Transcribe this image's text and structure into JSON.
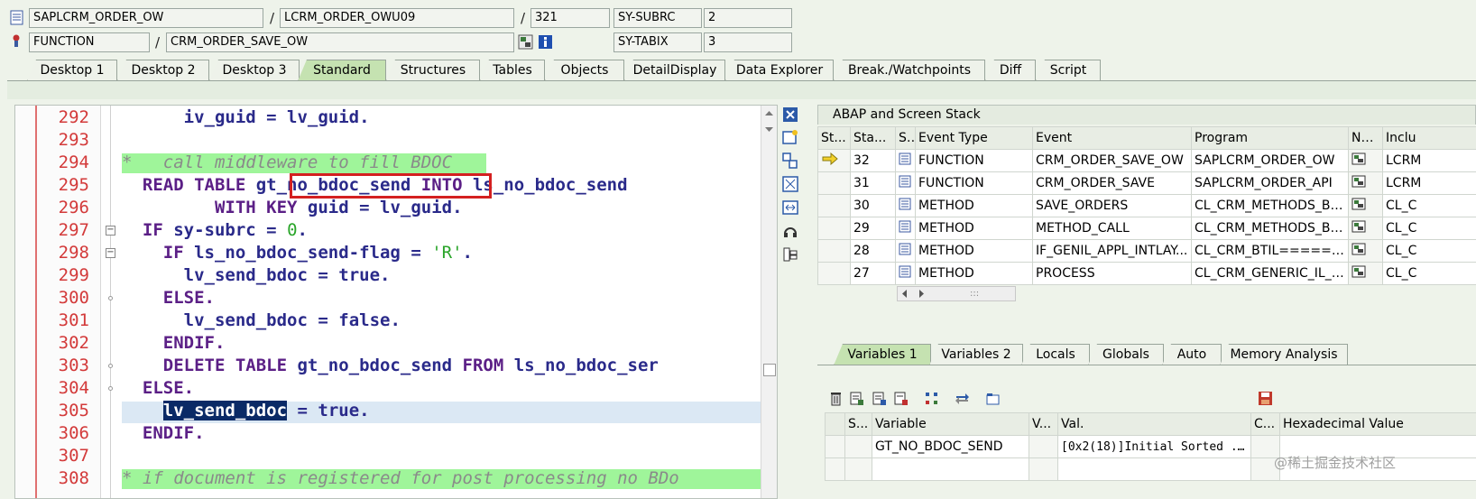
{
  "header": {
    "program": "SAPLCRM_ORDER_OW",
    "include": "LCRM_ORDER_OWU09",
    "line": "321",
    "sy_subrc_label": "SY-SUBRC",
    "sy_subrc_value": "2",
    "type": "FUNCTION",
    "name": "CRM_ORDER_SAVE_OW",
    "sy_tabix_label": "SY-TABIX",
    "sy_tabix_value": "3",
    "sep": "/"
  },
  "tabs": [
    "Desktop 1",
    "Desktop 2",
    "Desktop 3",
    "Standard",
    "Structures",
    "Tables",
    "Objects",
    "DetailDisplay",
    "Data Explorer",
    "Break./Watchpoints",
    "Diff",
    "Script"
  ],
  "editor": {
    "line_numbers": [
      "292",
      "293",
      "294",
      "295",
      "296",
      "297",
      "298",
      "299",
      "300",
      "301",
      "302",
      "303",
      "304",
      "305",
      "306",
      "307",
      "308"
    ]
  },
  "code": {
    "l292a": "iv_guid",
    "l292b": " = ",
    "l292c": "lv_guid",
    "l292d": ".",
    "l294": "*   call middleware to fill BDOC",
    "l295a": "READ TABLE ",
    "l295b": "gt_no_bdoc_send",
    "l295c": " INTO ",
    "l295d": "ls_no_bdoc_send",
    "l296a": "WITH KEY ",
    "l296b": "guid",
    "l296c": " = ",
    "l296d": "lv_guid",
    "l296e": ".",
    "l297a": "IF ",
    "l297b": "sy-subrc",
    "l297c": " = ",
    "l297d": "0",
    "l297e": ".",
    "l298a": "IF ",
    "l298b": "ls_no_bdoc_send-flag",
    "l298c": " = ",
    "l298d": "'R'",
    "l298e": ".",
    "l299a": "lv_send_bdoc",
    "l299b": " = ",
    "l299c": "true",
    "l299d": ".",
    "l300": "ELSE.",
    "l301a": "lv_send_bdoc",
    "l301b": " = ",
    "l301c": "false",
    "l301d": ".",
    "l302": "ENDIF.",
    "l303a": "DELETE TABLE ",
    "l303b": "gt_no_bdoc_send",
    "l303c": " FROM ",
    "l303d": "ls_no_bdoc_ser",
    "l304": "ELSE.",
    "l305a": "lv_send_bdoc",
    "l305b": " = ",
    "l305c": "true",
    "l305d": ".",
    "l306": "ENDIF.",
    "l308": "* if document is registered for post processing no BDo"
  },
  "stack": {
    "title": "ABAP and Screen Stack",
    "columns": [
      "St...",
      "Sta...",
      "S...",
      "Event Type",
      "Event",
      "Program",
      "Na...",
      "Inclu"
    ],
    "rows": [
      {
        "level": "32",
        "type": "FUNCTION",
        "event": "CRM_ORDER_SAVE_OW",
        "program": "SAPLCRM_ORDER_OW",
        "include": "LCRM"
      },
      {
        "level": "31",
        "type": "FUNCTION",
        "event": "CRM_ORDER_SAVE",
        "program": "SAPLCRM_ORDER_API",
        "include": "LCRM"
      },
      {
        "level": "30",
        "type": "METHOD",
        "event": "SAVE_ORDERS",
        "program": "CL_CRM_METHODS_BTIL...",
        "include": "CL_C"
      },
      {
        "level": "29",
        "type": "METHOD",
        "event": "METHOD_CALL",
        "program": "CL_CRM_METHODS_BTIL...",
        "include": "CL_C"
      },
      {
        "level": "28",
        "type": "METHOD",
        "event": "IF_GENIL_APPL_INTLAY...",
        "program": "CL_CRM_BTIL=======...",
        "include": "CL_C"
      },
      {
        "level": "27",
        "type": "METHOD",
        "event": "PROCESS",
        "program": "CL_CRM_GENERIC_IL_NE...",
        "include": "CL_C"
      }
    ],
    "scroll_grip": ":::"
  },
  "var_tabs": [
    "Variables 1",
    "Variables 2",
    "Locals",
    "Globals",
    "Auto",
    "Memory Analysis"
  ],
  "vars": {
    "columns": [
      "S...",
      "Variable",
      "V...",
      "Val.",
      "C...",
      "Hexadecimal Value"
    ],
    "rows": [
      {
        "variable": "GT_NO_BDOC_SEND",
        "value": "[0x2(18)]Initial Sorted ..."
      }
    ]
  },
  "watermark": "@稀土掘金技术社区",
  "colors": {
    "active_tab": "#c5e2b1",
    "comment_band": "#9ff59a",
    "line_number": "#d33a3a",
    "keyword": "#5b1f86",
    "highlight_box": "#d42020"
  }
}
